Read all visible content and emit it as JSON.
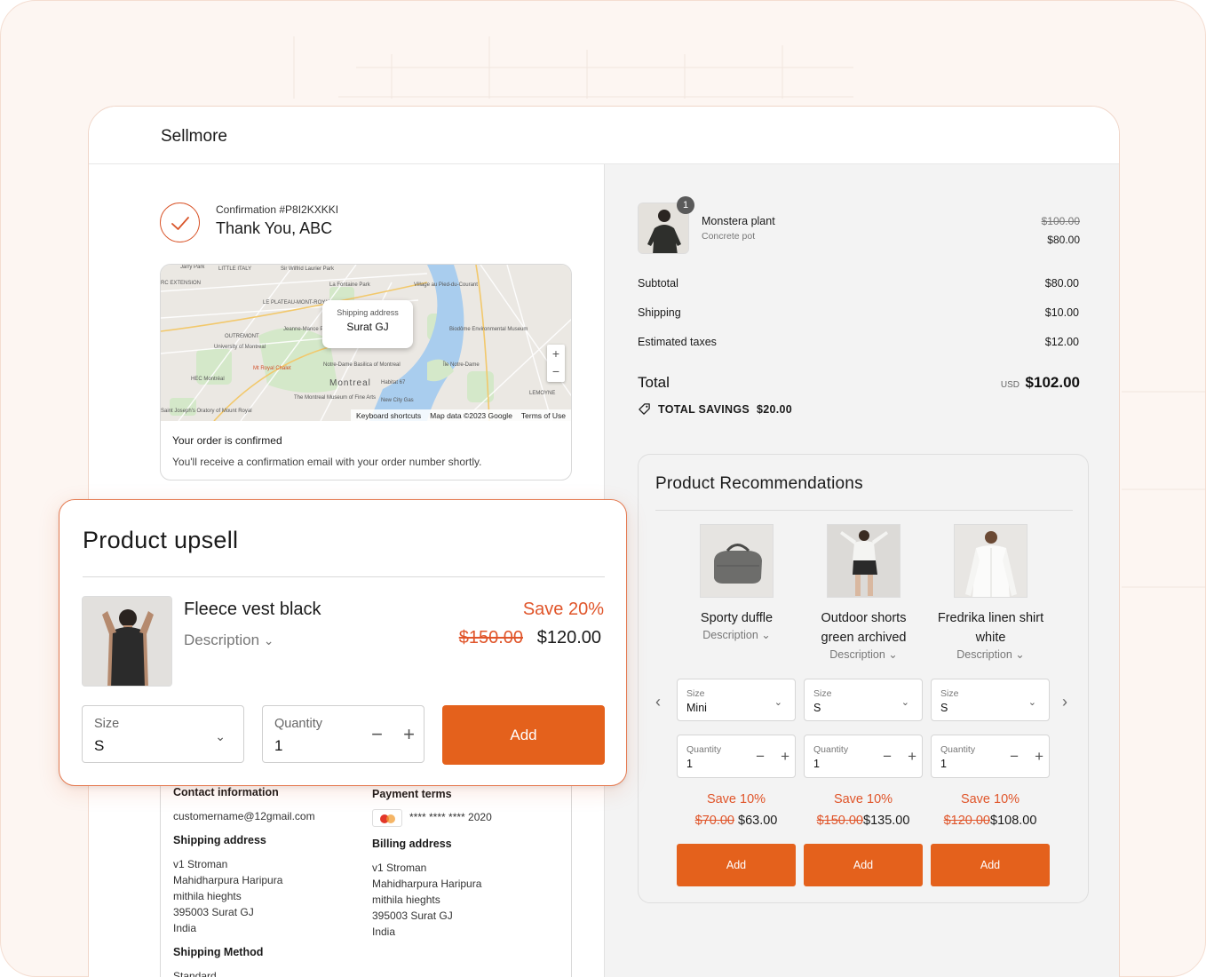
{
  "app": {
    "brand": "Sellmore"
  },
  "confirmation": {
    "number": "Confirmation #P8I2KXKKI",
    "greeting": "Thank You, ABC"
  },
  "map": {
    "popup_label": "Shipping address",
    "popup_value": "Surat GJ",
    "zoom_in": "+",
    "zoom_out": "−",
    "footer": [
      "Keyboard shortcuts",
      "Map data ©2023 Google",
      "Terms of Use"
    ],
    "places": [
      "Jarry Park",
      "LITTLE ITALY",
      "Sir Wilfrid Laurier Park",
      "RC EXTENSION",
      "La Fontaine Park",
      "Village au Pied-du-Courant",
      "LE PLATEAU-MONT-ROYAL",
      "Jeanne-Mance Park",
      "OUTREMONT",
      "Biodôme Environmental Museum",
      "University of Montreal",
      "Mt Royal Chalet",
      "Notre-Dame Basilica of Montreal",
      "Île Notre-Dame",
      "HEC Montréal",
      "Montreal",
      "Habitat 67",
      "The Montreal Museum of Fine Arts",
      "New City Gas",
      "Saint Joseph's Oratory of Mount Royal",
      "LEMOYNE"
    ]
  },
  "order_status": {
    "title": "Your order is confirmed",
    "subtitle": "You'll receive a confirmation email with your order number shortly."
  },
  "customer": {
    "contact_heading": "Contact information",
    "email": "customername@12gmail.com",
    "shipping_heading": "Shipping address",
    "shipping_lines": [
      "v1 Stroman",
      "Mahidharpura Haripura",
      "mithila hieghts",
      "395003 Surat GJ",
      "India"
    ],
    "method_heading": "Shipping Method",
    "method": "Standard",
    "payment_heading": "Payment terms",
    "card": "**** **** **** 2020",
    "billing_heading": "Billing address",
    "billing_lines": [
      "v1 Stroman",
      "Mahidharpura Haripura",
      "mithila hieghts",
      "395003 Surat GJ",
      "India"
    ]
  },
  "order_summary": {
    "item": {
      "name": "Monstera plant",
      "variant": "Concrete pot",
      "quantity": "1",
      "old_price": "$100.00",
      "price": "$80.00"
    },
    "subtotal_label": "Subtotal",
    "subtotal": "$80.00",
    "shipping_label": "Shipping",
    "shipping": "$10.00",
    "taxes_label": "Estimated taxes",
    "taxes": "$12.00",
    "total_label": "Total",
    "currency": "USD",
    "total": "$102.00",
    "savings_label": "TOTAL SAVINGS",
    "savings": "$20.00"
  },
  "recommendations": {
    "title": "Product Recommendations",
    "size_label": "Size",
    "quantity_label": "Quantity",
    "add_label": "Add",
    "items": [
      {
        "name": "Sporty duffle",
        "description": "Description",
        "size": "Mini",
        "quantity": "1",
        "save": "Save 10%",
        "old_price": "$70.00",
        "price": "$63.00"
      },
      {
        "name": "Outdoor shorts green archived",
        "description": "Description",
        "size": "S",
        "quantity": "1",
        "save": "Save 10%",
        "old_price": "$150.00",
        "price": "$135.00"
      },
      {
        "name": "Fredrika linen shirt white",
        "description": "Description",
        "size": "S",
        "quantity": "1",
        "save": "Save 10%",
        "old_price": "$120.00",
        "price": "$108.00"
      }
    ]
  },
  "upsell": {
    "title": "Product upsell",
    "product_name": "Fleece vest black",
    "description": "Description",
    "save": "Save 20%",
    "old_price": "$150.00",
    "price": "$120.00",
    "size_label": "Size",
    "size": "S",
    "quantity_label": "Quantity",
    "quantity": "1",
    "add_label": "Add"
  },
  "colors": {
    "accent": "#e4611c",
    "accent_text": "#e0552a",
    "panel_bg": "#f3f3f3"
  }
}
